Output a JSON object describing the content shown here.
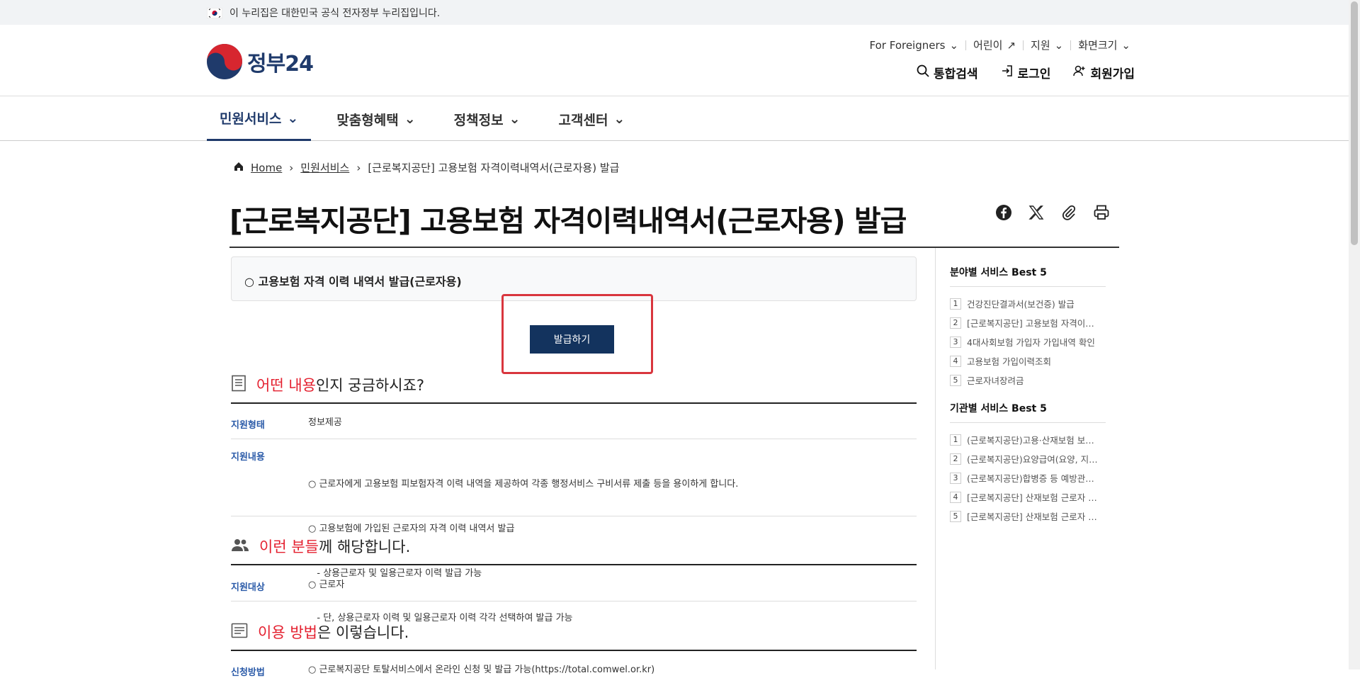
{
  "topbar": {
    "notice": "이 누리집은 대한민국 공식 전자정부 누리집입니다."
  },
  "logo": {
    "text": "정부24"
  },
  "util": {
    "foreigners": "For Foreigners",
    "kids": "어린이",
    "support": "지원",
    "fontsize": "화면크기"
  },
  "topmenu": {
    "search": "통합검색",
    "login": "로그인",
    "signup": "회원가입"
  },
  "gnb": [
    {
      "label": "민원서비스"
    },
    {
      "label": "맞춤형혜택"
    },
    {
      "label": "정책정보"
    },
    {
      "label": "고객센터"
    }
  ],
  "breadcrumb": {
    "home": "Home",
    "level1": "민원서비스",
    "current": "[근로복지공단] 고용보험 자격이력내역서(근로자용) 발급"
  },
  "page": {
    "title": "[근로복지공단] 고용보험 자격이력내역서(근로자용) 발급"
  },
  "service": {
    "option_label": "○ 고용보험 자격 이력 내역서 발급(근로자용)",
    "issue_button": "발급하기"
  },
  "section_what": {
    "red": "어떤 내용",
    "rest": "인지 궁금하시죠?"
  },
  "info": {
    "type_label": "지원형태",
    "type_value": "정보제공",
    "content_label": "지원내용",
    "content_lines": [
      "○ 근로자에게 고용보험 피보험자격 이력 내역을 제공하여 각종 행정서비스 구비서류 제출 등을 용이하게 합니다.",
      "○ 고용보험에 가입된 근로자의 자격 이력 내역서 발급",
      "   - 상용근로자 및 일용근로자 이력 발급 가능",
      "   - 단, 상용근로자 이력 및 일용근로자 이력 각각 선택하여 발급 가능"
    ]
  },
  "section_who": {
    "red": "이런 분들",
    "rest": "께 해당합니다."
  },
  "target": {
    "label": "지원대상",
    "value": "○ 근로자"
  },
  "section_how": {
    "red": "이용 방법",
    "rest": "은 이렇습니다."
  },
  "method": {
    "label": "신청방법",
    "value": "○ 근로복지공단 토탈서비스에서 온라인 신청 및 발급 가능(https://total.comwel.or.kr)"
  },
  "aside": {
    "best_field_title": "분야별 서비스 Best 5",
    "best_field": [
      "건강진단결과서(보건증) 발급",
      "[근로복지공단] 고용보험 자격이력내역서(근로자용) 발급",
      "4대사회보험 가입자 가입내역 확인",
      "고용보험 가입이력조회",
      "근로자녀장려금"
    ],
    "best_org_title": "기관별 서비스 Best 5",
    "best_org": [
      "(근로복지공단)고용·산재보험 보험료 신고",
      "(근로복지공단)요양급여(요양, 지급) 신청",
      "(근로복지공단)합병증 등 예방관리 신청",
      "[근로복지공단] 산재보험 근로자 자격이력",
      "[근로복지공단] 산재보험 근로자 증명원"
    ]
  },
  "colors": {
    "accent": "#13335e",
    "red": "#e4202f",
    "highlight": "#d9363e"
  }
}
